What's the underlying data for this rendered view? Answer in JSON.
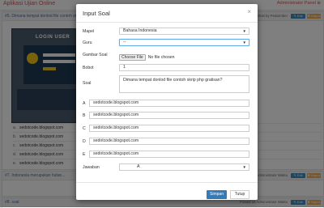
{
  "app": {
    "title": "Aplikasi Ujian Online",
    "user": "Administrator Panel ⊕"
  },
  "questions": [
    {
      "head": "#5. Dimana tempat donlod file contoh skrip ...",
      "posted": "Posted 2018 by Pedarmber",
      "answers": [
        {
          "letter": "a.",
          "text": "sedotcode.blogspot.com"
        },
        {
          "letter": "b.",
          "text": "sedotcode.blogspot.com"
        },
        {
          "letter": "c.",
          "text": "sedotcode.blogspot.com"
        },
        {
          "letter": "d.",
          "text": "sedotcode.blogspot.com"
        },
        {
          "letter": "e.",
          "text": "sedotcode.blogspot.com"
        }
      ]
    },
    {
      "head": "#7. Indonesia merupakan hutan...",
      "posted": "Posted 18 Administrator Waktu"
    },
    {
      "head": "#8. soal",
      "posted": "Posted 18 Administrator Waktu"
    }
  ],
  "actions": {
    "edit": "✎ Edit",
    "delete": "✖ Hapus"
  },
  "login_preview": {
    "title": "LOGIN USER"
  },
  "modal": {
    "title": "Input Soal",
    "close": "×",
    "fields": {
      "mapel": {
        "label": "Mapel",
        "value": "Bahasa Indonesia"
      },
      "guru": {
        "label": "Guru",
        "value": "--"
      },
      "gambar": {
        "label": "Gambar Soal",
        "button": "Choose File",
        "status": "No file chosen"
      },
      "bobot": {
        "label": "Bobot",
        "value": "1"
      },
      "soal": {
        "label": "Soal",
        "value": "Dimana tempat donlod file contoh skrip php gratisan?"
      }
    },
    "options": [
      {
        "label": "A",
        "value": "sedotcode.blogspot.com"
      },
      {
        "label": "B",
        "value": "sedotcode.blogspot.com"
      },
      {
        "label": "C",
        "value": "sedotcode.blogspot.com"
      },
      {
        "label": "D",
        "value": "sedotcode.blogspot.com"
      },
      {
        "label": "E",
        "value": "sedotcode.blogspot.com"
      }
    ],
    "jawaban": {
      "label": "Jawaban",
      "value": "A"
    },
    "buttons": {
      "save": "Simpan",
      "close": "Tutup"
    }
  },
  "colors": {
    "primary": "#337ab7",
    "warning": "#f0ad4e",
    "brand": "#d9534f"
  },
  "icons": {
    "dropdown": "caret-down-icon",
    "close": "close-icon"
  }
}
